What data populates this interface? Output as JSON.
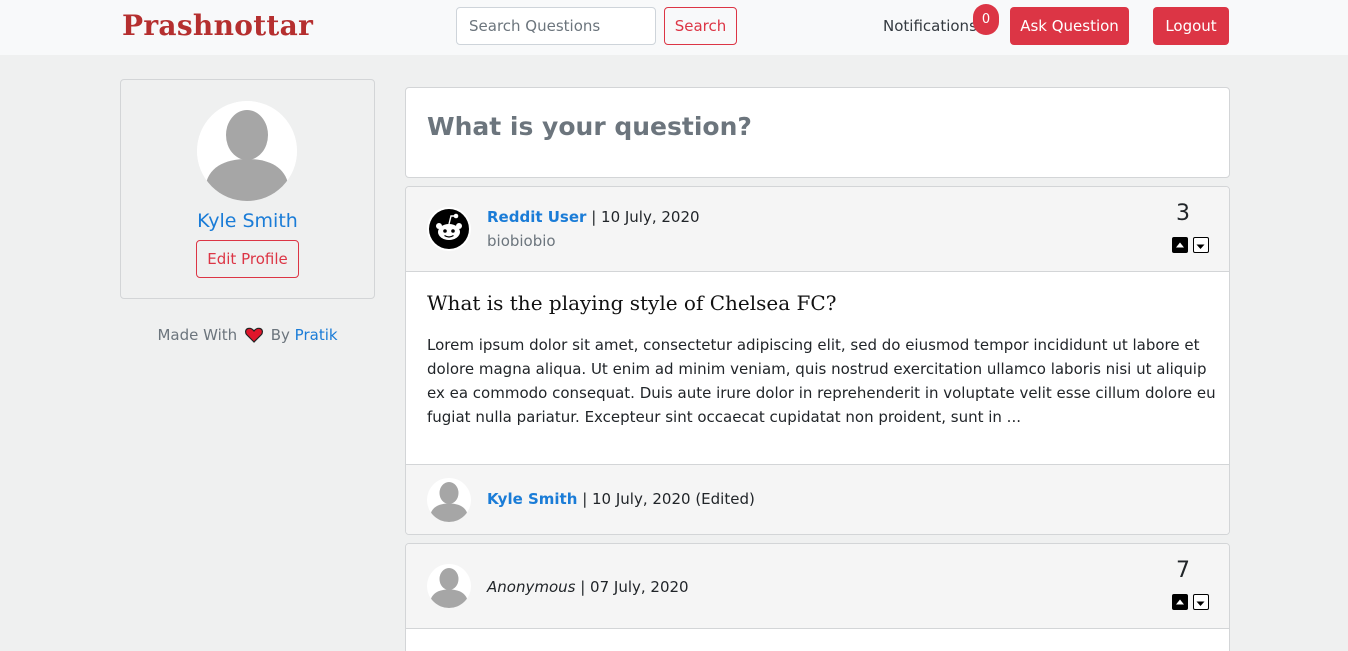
{
  "navbar": {
    "brand": "Prashnottar",
    "search_placeholder": "Search Questions",
    "search_label": "Search",
    "notifications_label": "Notifications",
    "notifications_count": "0",
    "ask_label": "Ask Question",
    "logout_label": "Logout"
  },
  "profile": {
    "name": "Kyle Smith",
    "edit_label": "Edit Profile"
  },
  "footer": {
    "made_with": "Made With",
    "by": "By",
    "author": "Pratik"
  },
  "ask_prompt": "What is your question?",
  "questions": [
    {
      "user": "Reddit User",
      "date": "| 10 July, 2020",
      "bio": "biobiobio",
      "votes": "3",
      "title": "What is the playing style of Chelsea FC?",
      "body": "Lorem ipsum dolor sit amet, consectetur adipiscing elit, sed do eiusmod tempor incididunt ut labore et dolore magna aliqua. Ut enim ad minim veniam, quis nostrud exercitation ullamco laboris nisi ut aliquip ex ea commodo consequat. Duis aute irure dolor in reprehenderit in voluptate velit esse cillum dolore eu fugiat nulla pariatur. Excepteur sint occaecat cupidatat non proident, sunt in ...",
      "answer": {
        "user": "Kyle Smith",
        "date": "| 10 July, 2020 (Edited)"
      }
    },
    {
      "user": "Anonymous",
      "date": "| 07 July, 2020",
      "votes": "7"
    }
  ],
  "colors": {
    "accent": "#dc3545",
    "link": "#1a7cd7",
    "brand": "#b52f2f"
  }
}
